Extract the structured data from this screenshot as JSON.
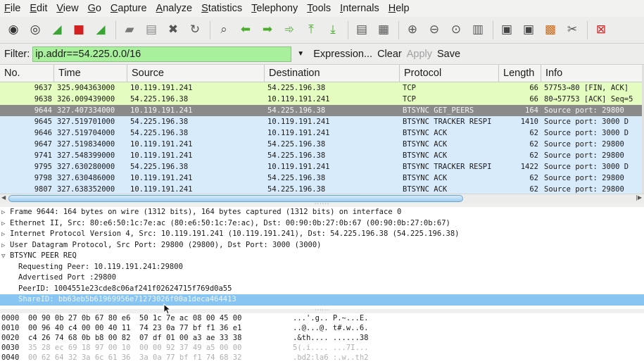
{
  "menu": [
    "File",
    "Edit",
    "View",
    "Go",
    "Capture",
    "Analyze",
    "Statistics",
    "Telephony",
    "Tools",
    "Internals",
    "Help"
  ],
  "toolbar": {
    "groups": [
      [
        {
          "name": "interface-list-icon",
          "glyph": "◉",
          "color": "#333"
        },
        {
          "name": "capture-options-icon",
          "glyph": "◎",
          "color": "#333"
        },
        {
          "name": "start-capture-icon",
          "glyph": "◢",
          "color": "#3aa535"
        },
        {
          "name": "stop-capture-icon",
          "glyph": "■",
          "color": "#d42020"
        },
        {
          "name": "restart-capture-icon",
          "glyph": "◢",
          "color": "#3aa535"
        }
      ],
      [
        {
          "name": "open-file-icon",
          "glyph": "▰",
          "color": "#777"
        },
        {
          "name": "save-file-icon",
          "glyph": "▤",
          "color": "#888"
        },
        {
          "name": "close-file-icon",
          "glyph": "✖",
          "color": "#555"
        },
        {
          "name": "reload-icon",
          "glyph": "↻",
          "color": "#555"
        }
      ],
      [
        {
          "name": "find-packet-icon",
          "glyph": "⌕",
          "color": "#555"
        },
        {
          "name": "go-back-icon",
          "glyph": "⬅",
          "color": "#4cab2e"
        },
        {
          "name": "go-forward-icon",
          "glyph": "➡",
          "color": "#4cab2e"
        },
        {
          "name": "go-to-packet-icon",
          "glyph": "➾",
          "color": "#4cab2e"
        },
        {
          "name": "go-first-icon",
          "glyph": "⤒",
          "color": "#4cab2e"
        },
        {
          "name": "go-last-icon",
          "glyph": "⤓",
          "color": "#4cab2e"
        }
      ],
      [
        {
          "name": "colorize-icon",
          "glyph": "▤",
          "color": "#555"
        },
        {
          "name": "autoscroll-icon",
          "glyph": "▦",
          "color": "#555"
        }
      ],
      [
        {
          "name": "zoom-in-icon",
          "glyph": "⊕",
          "color": "#555"
        },
        {
          "name": "zoom-out-icon",
          "glyph": "⊖",
          "color": "#555"
        },
        {
          "name": "zoom-normal-icon",
          "glyph": "⊙",
          "color": "#555"
        },
        {
          "name": "resize-columns-icon",
          "glyph": "▥",
          "color": "#555"
        }
      ],
      [
        {
          "name": "capture-filters-icon",
          "glyph": "▣",
          "color": "#444"
        },
        {
          "name": "display-filters-icon",
          "glyph": "▣",
          "color": "#444"
        },
        {
          "name": "coloring-rules-icon",
          "glyph": "▩",
          "color": "#d06a1a"
        },
        {
          "name": "preferences-icon",
          "glyph": "✂",
          "color": "#555"
        }
      ],
      [
        {
          "name": "help-icon",
          "glyph": "⊠",
          "color": "#d42020"
        }
      ]
    ]
  },
  "filter": {
    "label": "Filter:",
    "value": "ip.addr==54.225.0.0/16",
    "expression": "Expression...",
    "clear": "Clear",
    "apply": "Apply",
    "save": "Save"
  },
  "columns": {
    "no": "No.",
    "time": "Time",
    "source": "Source",
    "destination": "Destination",
    "protocol": "Protocol",
    "length": "Length",
    "info": "Info"
  },
  "packets": [
    {
      "no": "9637",
      "time": "325.904363000",
      "src": "10.119.191.241",
      "dst": "54.225.196.38",
      "proto": "TCP",
      "len": "66",
      "info": "57753→80 [FIN, ACK]",
      "bg": "#e4fcc0",
      "fg": "#1a1a1a"
    },
    {
      "no": "9638",
      "time": "326.009439000",
      "src": "54.225.196.38",
      "dst": "10.119.191.241",
      "proto": "TCP",
      "len": "66",
      "info": "80→57753 [ACK] Seq=5",
      "bg": "#e4fcc0",
      "fg": "#1a1a1a"
    },
    {
      "no": "9644",
      "time": "327.407334000",
      "src": "10.119.191.241",
      "dst": "54.225.196.38",
      "proto": "BTSYNC GET_PEERS",
      "len": "164",
      "info": "Source port: 29800",
      "bg": "#8a8a8a",
      "fg": "#f4f4f4"
    },
    {
      "no": "9645",
      "time": "327.519701000",
      "src": "54.225.196.38",
      "dst": "10.119.191.241",
      "proto": "BTSYNC TRACKER RESPI",
      "len": "1410",
      "info": "Source port: 3000  D",
      "bg": "#d8ebfb",
      "fg": "#1a1a1a"
    },
    {
      "no": "9646",
      "time": "327.519704000",
      "src": "54.225.196.38",
      "dst": "10.119.191.241",
      "proto": "BTSYNC ACK",
      "len": "62",
      "info": "Source port: 3000  D",
      "bg": "#d8ebfb",
      "fg": "#1a1a1a"
    },
    {
      "no": "9647",
      "time": "327.519834000",
      "src": "10.119.191.241",
      "dst": "54.225.196.38",
      "proto": "BTSYNC ACK",
      "len": "62",
      "info": "Source port: 29800",
      "bg": "#d8ebfb",
      "fg": "#1a1a1a"
    },
    {
      "no": "9741",
      "time": "327.548399000",
      "src": "10.119.191.241",
      "dst": "54.225.196.38",
      "proto": "BTSYNC ACK",
      "len": "62",
      "info": "Source port: 29800",
      "bg": "#d8ebfb",
      "fg": "#1a1a1a"
    },
    {
      "no": "9795",
      "time": "327.630280000",
      "src": "54.225.196.38",
      "dst": "10.119.191.241",
      "proto": "BTSYNC TRACKER RESPI",
      "len": "1422",
      "info": "Source port: 3000  D",
      "bg": "#d8ebfb",
      "fg": "#1a1a1a"
    },
    {
      "no": "9798",
      "time": "327.630486000",
      "src": "10.119.191.241",
      "dst": "54.225.196.38",
      "proto": "BTSYNC ACK",
      "len": "62",
      "info": "Source port: 29800",
      "bg": "#d8ebfb",
      "fg": "#1a1a1a"
    },
    {
      "no": "9807",
      "time": "327.638352000",
      "src": "10.119.191.241",
      "dst": "54.225.196.38",
      "proto": "BTSYNC ACK",
      "len": "62",
      "info": "Source port: 29800",
      "bg": "#d8ebfb",
      "fg": "#1a1a1a"
    }
  ],
  "details": [
    {
      "text": "Frame 9644: 164 bytes on wire (1312 bits), 164 bytes captured (1312 bits) on interface 0",
      "arrow": "▷",
      "level": 0,
      "selected": false
    },
    {
      "text": "Ethernet II, Src: 80:e6:50:1c:7e:ac (80:e6:50:1c:7e:ac), Dst: 00:90:0b:27:0b:67 (00:90:0b:27:0b:67)",
      "arrow": "▷",
      "level": 0,
      "selected": false
    },
    {
      "text": "Internet Protocol Version 4, Src: 10.119.191.241 (10.119.191.241), Dst: 54.225.196.38 (54.225.196.38)",
      "arrow": "▷",
      "level": 0,
      "selected": false
    },
    {
      "text": "User Datagram Protocol, Src Port: 29800 (29800), Dst Port: 3000 (3000)",
      "arrow": "▷",
      "level": 0,
      "selected": false
    },
    {
      "text": "BTSYNC PEER REQ",
      "arrow": "▽",
      "level": 0,
      "selected": false
    },
    {
      "text": "Requesting Peer: 10.119.191.241:29800",
      "arrow": "",
      "level": 1,
      "selected": false
    },
    {
      "text": "Advertised Port :29800",
      "arrow": "",
      "level": 1,
      "selected": false
    },
    {
      "text": "PeerID: 1004551e23cde8c06af241f02624715f769d0a55",
      "arrow": "",
      "level": 1,
      "selected": false
    },
    {
      "text": "ShareID: bb63eb5b61969956e71273026f00a1deca464413",
      "arrow": "",
      "level": 1,
      "selected": true
    }
  ],
  "hex": [
    {
      "off": "0000",
      "bytes": "00 90 0b 27 0b 67 80 e6  50 1c 7e ac 08 00 45 00",
      "ascii": "...'.g.. P.~...E.",
      "dim_from": 99
    },
    {
      "off": "0010",
      "bytes": "00 96 40 c4 00 00 40 11  74 23 0a 77 bf f1 36 e1",
      "ascii": "..@...@. t#.w..6.",
      "dim_from": 99
    },
    {
      "off": "0020",
      "bytes": "c4 26 74 68 0b b8 00 82  07 df 01 00 a3 ae 33 38",
      "ascii": ".&th.... ......38",
      "dim_from": 10
    },
    {
      "off": "0030",
      "bytes": "35 28 ec 69 18 97 00 10  00 00 92 37 49 a5 00 00",
      "ascii": "5(.i.... ...7I...",
      "dim_from": 0
    },
    {
      "off": "0040",
      "bytes": "00 62 64 32 3a 6c 61 36  3a 0a 77 bf f1 74 68 32",
      "ascii": ".bd2:la6 :.w..th2",
      "dim_from": 0
    }
  ]
}
